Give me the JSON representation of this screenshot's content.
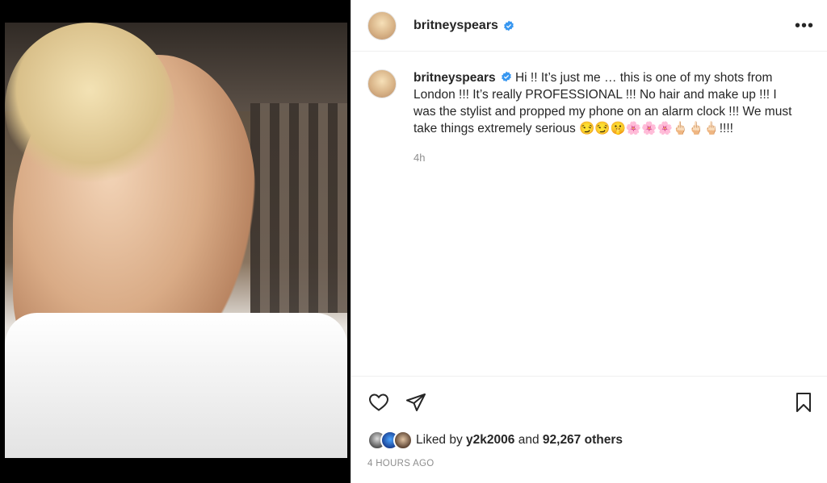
{
  "post": {
    "username": "britneyspears",
    "caption": "Hi !! It’s just me … this is one of my shots from London !!! It’s really PROFESSIONAL !!! No hair and make up !!! I was the stylist and propped my phone on an alarm clock !!! We must take things extremely serious 😏😏🤫🌸🌸🌸🖕🏻🖕🏻🖕🏻!!!!",
    "caption_time": "4h",
    "liked_by_prefix": "Liked by",
    "liked_by_user": "y2k2006",
    "liked_by_and": "and",
    "liked_by_others": "92,267 others",
    "posted_ago": "4 HOURS AGO",
    "more_label": "•••"
  },
  "icons": {
    "verified": "verified-badge-icon",
    "like": "heart-icon",
    "share": "paper-plane-icon",
    "save": "bookmark-icon",
    "more": "more-options-icon"
  },
  "colors": {
    "verified_blue": "#3897f0",
    "text": "#262626",
    "muted": "#8e8e8e"
  }
}
